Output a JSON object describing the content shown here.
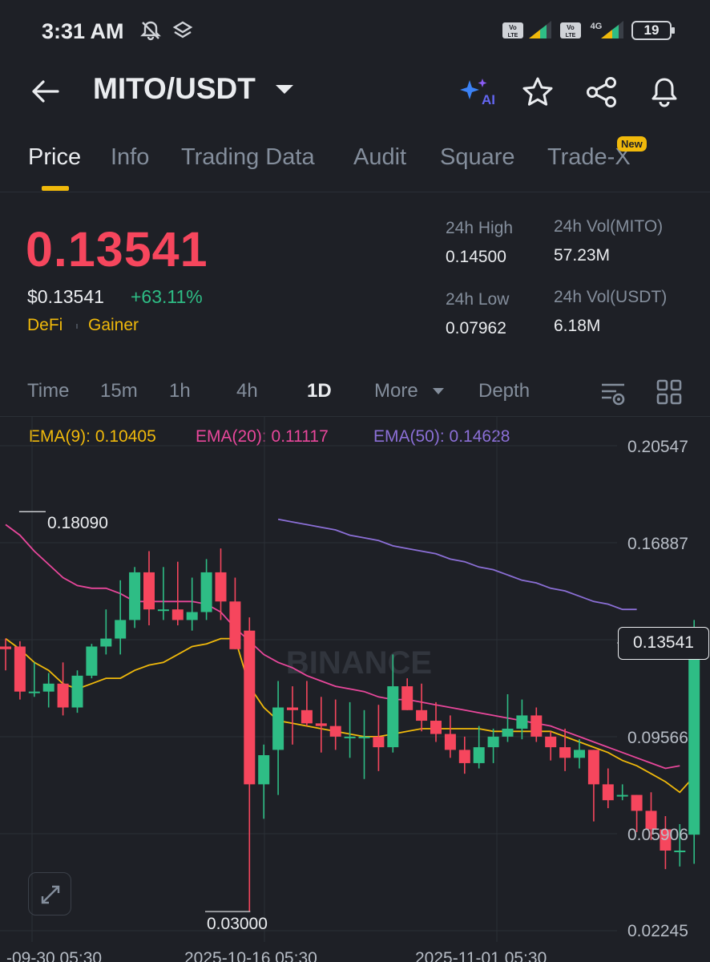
{
  "status_bar": {
    "time": "3:31 AM",
    "battery": "19"
  },
  "header": {
    "pair": "MITO/USDT"
  },
  "tabs": [
    {
      "label": "Price"
    },
    {
      "label": "Info"
    },
    {
      "label": "Trading Data"
    },
    {
      "label": "Audit"
    },
    {
      "label": "Square"
    },
    {
      "label": "Trade-X"
    }
  ],
  "new_badge": "New",
  "ticker": {
    "last_price": "0.13541",
    "usd_price": "$0.13541",
    "change": "+63.11%",
    "tags": [
      "DeFi",
      "Gainer"
    ]
  },
  "stats": {
    "high_label": "24h High",
    "high": "0.14500",
    "low_label": "24h Low",
    "low": "0.07962",
    "vol_mito_label": "24h Vol(MITO)",
    "vol_mito": "57.23M",
    "vol_usdt_label": "24h Vol(USDT)",
    "vol_usdt": "6.18M"
  },
  "intervals": [
    {
      "label": "Time"
    },
    {
      "label": "15m"
    },
    {
      "label": "1h"
    },
    {
      "label": "4h"
    },
    {
      "label": "1D"
    },
    {
      "label": "More"
    },
    {
      "label": "Depth"
    }
  ],
  "ema": {
    "ema9": "EMA(9): 0.10405",
    "ema20": "EMA(20): 0.11117",
    "ema50": "EMA(50): 0.14628"
  },
  "colors": {
    "up": "#2ebd85",
    "down": "#f6465d",
    "accent": "#f0b90b",
    "ema9": "#f0b90b",
    "ema20": "#e8479b",
    "ema50": "#8b6fd6"
  },
  "icons": [
    "back-arrow-icon",
    "ai-sparkle-icon",
    "star-icon",
    "share-icon",
    "bell-icon",
    "chart-settings-icon",
    "grid-layout-icon",
    "expand-icon"
  ],
  "chart_data": {
    "type": "candlestick",
    "watermark": "BINANCE",
    "price_axis": [
      "0.20547",
      "0.16887",
      "0.13541",
      "0.09566",
      "0.05906",
      "0.02245"
    ],
    "current_price": "0.13541",
    "ylim": [
      0.02245,
      0.20547
    ],
    "x_labels": [
      "-09-30 05:30",
      "2025-10-16 05:30",
      "2025-11-01 05:30"
    ],
    "high_marker": "0.18090",
    "low_marker": "0.03000",
    "candles": [
      [
        0.13,
        0.133,
        0.121,
        0.129
      ],
      [
        0.13,
        0.132,
        0.11,
        0.113
      ],
      [
        0.113,
        0.124,
        0.111,
        0.113
      ],
      [
        0.113,
        0.12,
        0.107,
        0.116
      ],
      [
        0.116,
        0.124,
        0.104,
        0.107
      ],
      [
        0.107,
        0.121,
        0.105,
        0.119
      ],
      [
        0.119,
        0.131,
        0.118,
        0.13
      ],
      [
        0.13,
        0.144,
        0.127,
        0.133
      ],
      [
        0.133,
        0.155,
        0.127,
        0.14
      ],
      [
        0.14,
        0.16,
        0.137,
        0.158
      ],
      [
        0.158,
        0.166,
        0.138,
        0.144
      ],
      [
        0.144,
        0.16,
        0.14,
        0.144
      ],
      [
        0.144,
        0.162,
        0.138,
        0.14
      ],
      [
        0.14,
        0.156,
        0.136,
        0.143
      ],
      [
        0.143,
        0.163,
        0.14,
        0.158
      ],
      [
        0.158,
        0.167,
        0.14,
        0.147
      ],
      [
        0.147,
        0.156,
        0.129,
        0.129
      ],
      [
        0.136,
        0.141,
        0.03,
        0.078
      ],
      [
        0.078,
        0.093,
        0.065,
        0.089
      ],
      [
        0.091,
        0.117,
        0.074,
        0.107
      ],
      [
        0.107,
        0.115,
        0.093,
        0.106
      ],
      [
        0.106,
        0.117,
        0.1,
        0.101
      ],
      [
        0.101,
        0.111,
        0.09,
        0.1
      ],
      [
        0.1,
        0.11,
        0.091,
        0.096
      ],
      [
        0.096,
        0.109,
        0.088,
        0.096
      ],
      [
        0.096,
        0.106,
        0.08,
        0.096
      ],
      [
        0.096,
        0.108,
        0.083,
        0.092
      ],
      [
        0.092,
        0.127,
        0.09,
        0.115
      ],
      [
        0.115,
        0.118,
        0.106,
        0.106
      ],
      [
        0.106,
        0.116,
        0.098,
        0.102
      ],
      [
        0.102,
        0.109,
        0.094,
        0.097
      ],
      [
        0.097,
        0.104,
        0.088,
        0.091
      ],
      [
        0.091,
        0.096,
        0.082,
        0.086
      ],
      [
        0.086,
        0.1,
        0.084,
        0.092
      ],
      [
        0.092,
        0.099,
        0.086,
        0.096
      ],
      [
        0.096,
        0.112,
        0.094,
        0.099
      ],
      [
        0.099,
        0.11,
        0.095,
        0.104
      ],
      [
        0.104,
        0.107,
        0.094,
        0.096
      ],
      [
        0.096,
        0.098,
        0.087,
        0.092
      ],
      [
        0.092,
        0.099,
        0.083,
        0.088
      ],
      [
        0.088,
        0.095,
        0.084,
        0.091
      ],
      [
        0.091,
        0.091,
        0.064,
        0.078
      ],
      [
        0.078,
        0.084,
        0.069,
        0.072
      ],
      [
        0.074,
        0.078,
        0.072,
        0.074
      ],
      [
        0.074,
        0.074,
        0.06,
        0.068
      ],
      [
        0.068,
        0.075,
        0.057,
        0.061
      ],
      [
        0.061,
        0.066,
        0.046,
        0.053
      ],
      [
        0.053,
        0.063,
        0.047,
        0.053
      ],
      [
        0.059,
        0.14,
        0.048,
        0.13
      ]
    ],
    "ema9": [
      0.133,
      0.129,
      0.124,
      0.121,
      0.116,
      0.114,
      0.116,
      0.118,
      0.118,
      0.121,
      0.123,
      0.124,
      0.127,
      0.13,
      0.131,
      0.133,
      0.133,
      0.115,
      0.107,
      0.102,
      0.101,
      0.1,
      0.099,
      0.098,
      0.097,
      0.096,
      0.096,
      0.097,
      0.098,
      0.099,
      0.099,
      0.099,
      0.099,
      0.099,
      0.098,
      0.098,
      0.098,
      0.098,
      0.098,
      0.096,
      0.094,
      0.092,
      0.09,
      0.087,
      0.085,
      0.082,
      0.079,
      0.075,
      0.081
    ],
    "ema20": [
      0.176,
      0.172,
      0.166,
      0.161,
      0.156,
      0.153,
      0.152,
      0.152,
      0.15,
      0.147,
      0.147,
      0.147,
      0.147,
      0.147,
      0.146,
      0.143,
      0.137,
      0.132,
      0.127,
      0.124,
      0.122,
      0.119,
      0.117,
      0.115,
      0.114,
      0.113,
      0.111,
      0.11,
      0.11,
      0.109,
      0.108,
      0.107,
      0.106,
      0.105,
      0.104,
      0.103,
      0.102,
      0.101,
      0.1,
      0.098,
      0.096,
      0.094,
      0.092,
      0.09,
      0.088,
      0.086,
      0.084,
      0.085
    ],
    "ema50": [
      0.178,
      0.177,
      0.176,
      0.175,
      0.174,
      0.172,
      0.171,
      0.17,
      0.168,
      0.167,
      0.166,
      0.165,
      0.163,
      0.162,
      0.16,
      0.159,
      0.157,
      0.155,
      0.154,
      0.152,
      0.151,
      0.149,
      0.147,
      0.146,
      0.144,
      0.144
    ]
  }
}
